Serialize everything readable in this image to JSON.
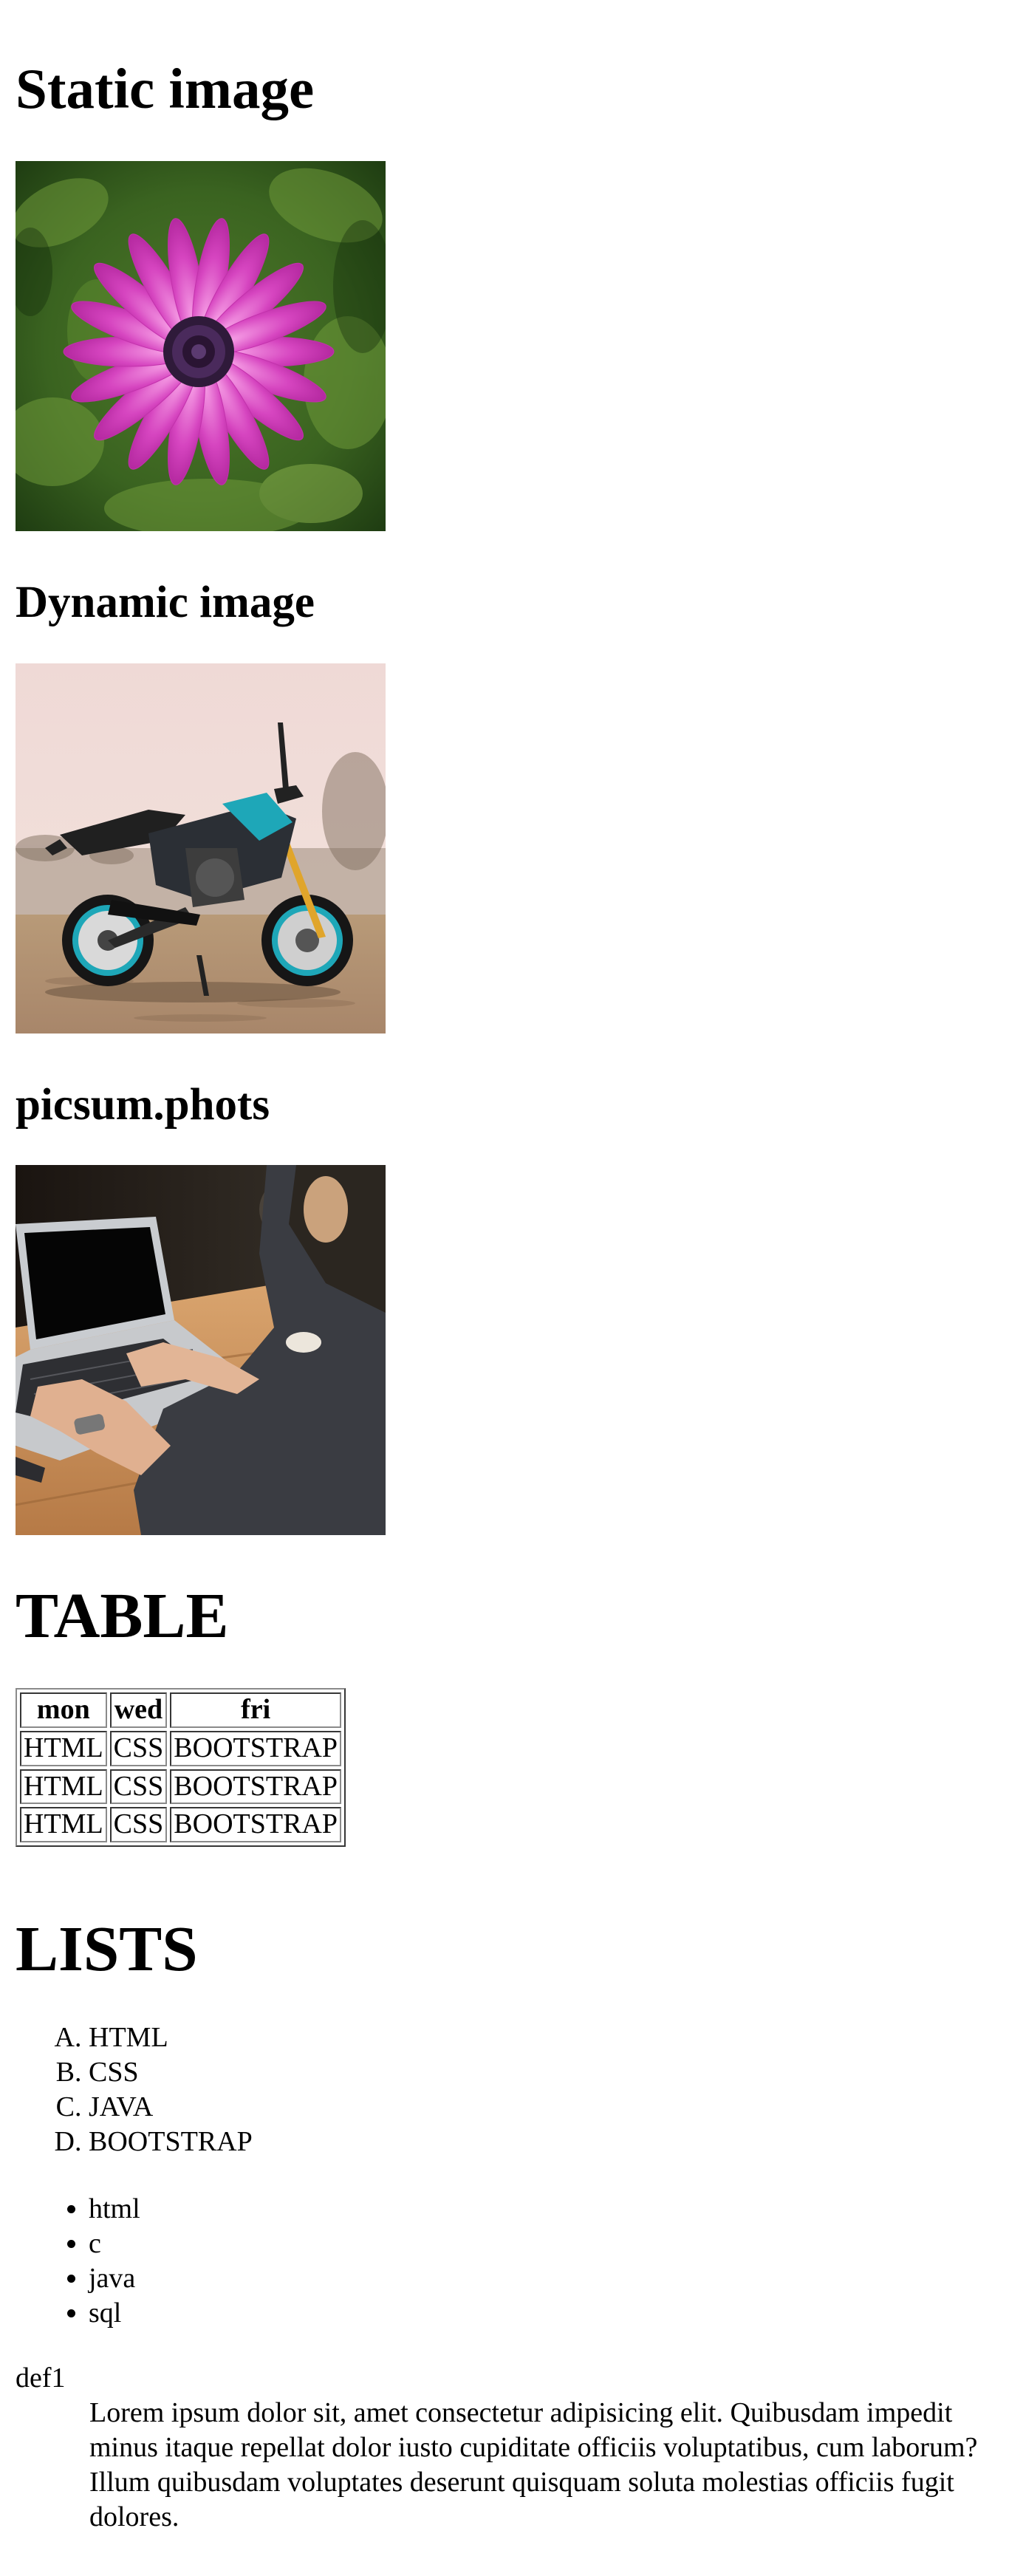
{
  "headings": {
    "static": "Static image",
    "dynamic": "Dynamic image",
    "picsum": "picsum.phots",
    "table": "TABLE",
    "lists": "LISTS"
  },
  "table": {
    "headers": [
      "mon",
      "wed",
      "fri"
    ],
    "rows": [
      [
        "HTML",
        "CSS",
        "BOOTSTRAP"
      ],
      [
        "HTML",
        "CSS",
        "BOOTSTRAP"
      ],
      [
        "HTML",
        "CSS",
        "BOOTSTRAP"
      ]
    ]
  },
  "ordered_list": [
    "HTML",
    "CSS",
    "JAVA",
    "BOOTSTRAP"
  ],
  "unordered_list": [
    "html",
    "c",
    "java",
    "sql"
  ],
  "definitions": [
    {
      "term": "def1",
      "description": "Lorem ipsum dolor sit, amet consectetur adipisicing elit. Quibusdam impedit minus itaque repellat dolor iusto cupiditate officiis voluptatibus, cum laborum? Illum quibusdam voluptates deserunt quisquam soluta molestias officiis fugit dolores."
    }
  ]
}
